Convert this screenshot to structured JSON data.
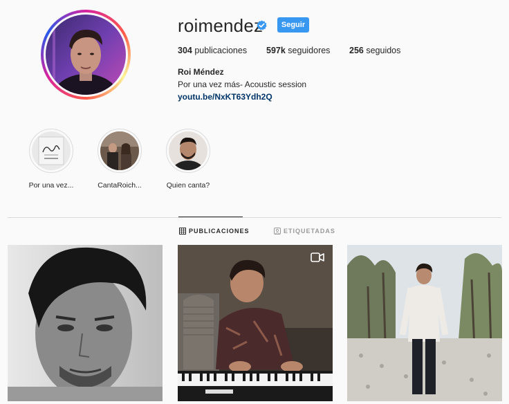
{
  "profile": {
    "username": "roimendez",
    "follow_label": "Seguir",
    "full_name": "Roi Méndez",
    "bio": "Por una vez más- Acoustic session",
    "link": "youtu.be/NxKT63Ydh2Q"
  },
  "stats": {
    "posts_num": "304",
    "posts_label": " publicaciones",
    "followers_num": "597k",
    "followers_label": " seguidores",
    "following_num": "256",
    "following_label": " seguidos"
  },
  "highlights": [
    {
      "label": "Por una vez..."
    },
    {
      "label": "CantaRoich..."
    },
    {
      "label": "Quien canta?"
    }
  ],
  "tabs": {
    "posts": "PUBLICACIONES",
    "tagged": "ETIQUETADAS"
  },
  "colors": {
    "follow_button": "#3897f0",
    "link": "#003569",
    "verified": "#3897f0"
  },
  "icons": [
    "verified-badge-icon",
    "grid-icon",
    "tagged-icon",
    "video-icon"
  ]
}
